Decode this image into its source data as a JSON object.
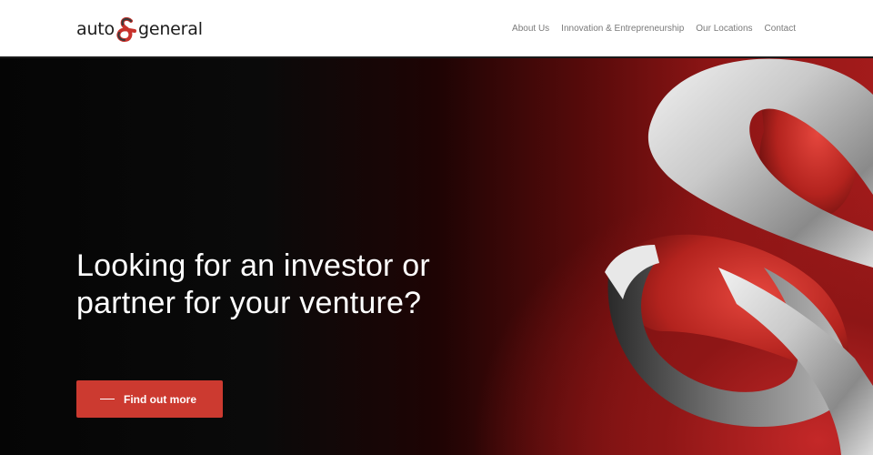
{
  "brand": {
    "word_left": "auto",
    "word_right": "general",
    "logo_icon": "ampersand-logo-icon",
    "colors": {
      "red": "#c8322c",
      "dark": "#1c1c1c"
    }
  },
  "nav": {
    "items": [
      {
        "label": "About Us"
      },
      {
        "label": "Innovation & Entrepreneurship"
      },
      {
        "label": "Our Locations"
      },
      {
        "label": "Contact"
      }
    ]
  },
  "hero": {
    "headline": "Looking for an investor or partner for your venture?",
    "cta": {
      "label": "Find out more",
      "icon": "dash-icon",
      "color": "#cc3a30"
    },
    "art_icon": "ampersand-sculpture-icon"
  }
}
